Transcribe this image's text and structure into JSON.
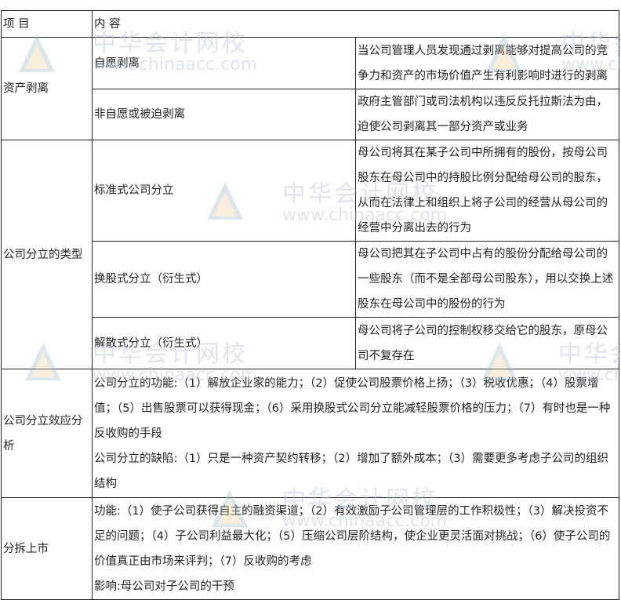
{
  "header": {
    "col1": "项 目",
    "col2": "内 容"
  },
  "rows": {
    "stripping": {
      "label": "资产剥离",
      "sub": [
        {
          "type": "自愿剥离",
          "content": "当公司管理人员发现通过剥离能够对提高公司的竞争力和资产的市场价值产生有利影响时进行的剥离"
        },
        {
          "type": "非自愿或被迫剥离",
          "content": "政府主管部门或司法机构以违反反托拉斯法为由，迫使公司剥离其一部分资产或业务"
        }
      ]
    },
    "split_types": {
      "label": "公司分立的类型",
      "sub": [
        {
          "type": "标准式公司分立",
          "content": "母公司将其在某子公司中所拥有的股份，按母公司股东在母公司中的持股比例分配给母公司的股东，从而在法律上和组织上将子公司的经营从母公司的经营中分离出去的行为"
        },
        {
          "type": "换股式分立（衍生式）",
          "content": "母公司把其在子公司中占有的股份分配给母公司的一些股东（而不是全部母公司股东），用以交换上述股东在母公司中的股份的行为"
        },
        {
          "type": "解散式分立（衍生式）",
          "content": "母公司将子公司的控制权移交给它的股东，原母公司不复存在"
        }
      ]
    },
    "split_effect": {
      "label": "公司分立效应分析",
      "functions": "公司分立的功能:（1）解放企业家的能力；（2）促使公司股票价格上扬；（3）税收优惠；（4）股票增值；（5）出售股票可以获得现金；（6）采用换股式公司分立能减轻股票价格的压力；（7）有时也是一种反收购的手段",
      "drawbacks": "公司分立的缺陷:（1）只是一种资产契约转移；（2）增加了额外成本；（3）需要更多考虑子公司的组织结构"
    },
    "carve_out": {
      "label": "分拆上市",
      "functions": "功能:（1）使子公司获得自主的融资渠道；（2）有效激励子公司管理层的工作积极性；（3）解决投资不足的问题；（4）子公司利益最大化；（5）压缩公司层阶结构，使企业更灵活面对挑战；（6）使子公司的价值真正由市场来评判；（7）反收购的考虑",
      "impact": "影响:母公司对子公司的干预"
    }
  },
  "watermark": {
    "cn": "中华会计网校",
    "en": "www.chinaacc.com"
  }
}
